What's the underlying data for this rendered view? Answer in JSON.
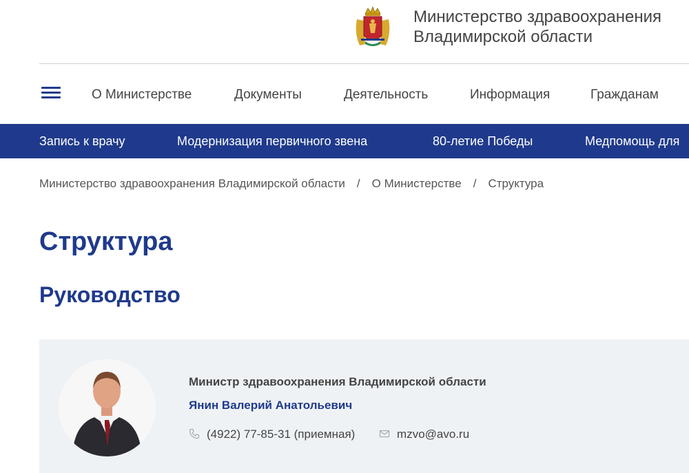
{
  "header": {
    "org_name_line1": "Министерство здравоохранения",
    "org_name_line2": "Владимирской области",
    "logo_icon": "coat-of-arms-icon"
  },
  "top_nav": {
    "menu_icon": "hamburger-menu-icon",
    "items": [
      {
        "label": "О Министерстве"
      },
      {
        "label": "Документы"
      },
      {
        "label": "Деятельность"
      },
      {
        "label": "Информация"
      },
      {
        "label": "Гражданам"
      }
    ]
  },
  "quick_links": {
    "items": [
      {
        "label": "Запись к врачу"
      },
      {
        "label": "Модернизация первичного звена"
      },
      {
        "label": "80-летие Победы"
      },
      {
        "label": "Медпомощь для"
      }
    ]
  },
  "breadcrumb": {
    "items": [
      {
        "label": "Министерство здравоохранения Владимирской области"
      },
      {
        "label": "О Министерстве"
      },
      {
        "label": "Структура"
      }
    ],
    "separator": "/"
  },
  "page": {
    "title": "Структура",
    "section_title": "Руководство"
  },
  "person": {
    "role": "Министр здравоохранения Владимирской области",
    "name": "Янин Валерий Анатольевич",
    "phone": "(4922) 77-85-31 (приемная)",
    "email": "mzvo@avo.ru"
  },
  "colors": {
    "brand_blue": "#1f3a8c",
    "card_bg": "#eff2f5"
  }
}
